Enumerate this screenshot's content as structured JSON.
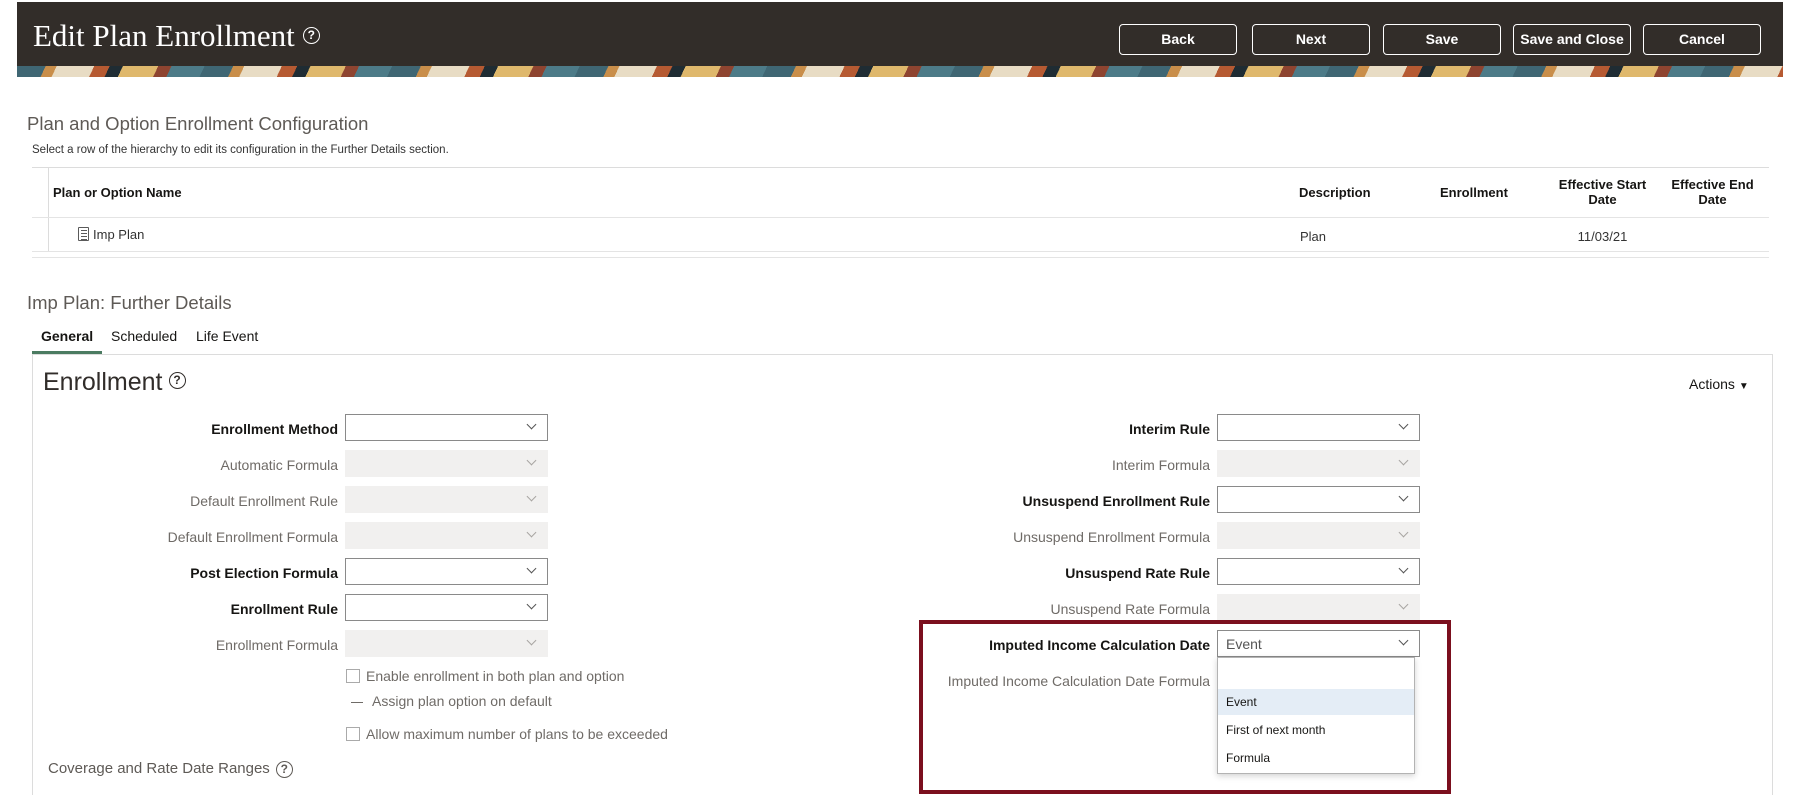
{
  "header": {
    "title": "Edit Plan Enrollment",
    "buttons": {
      "back": "Back",
      "next": "Next",
      "save": "Save",
      "save_close": "Save and Close",
      "cancel": "Cancel"
    }
  },
  "hierarchy": {
    "title": "Plan and Option Enrollment Configuration",
    "instruction": "Select a row of the hierarchy to edit its configuration in the Further Details section.",
    "columns": {
      "name": "Plan or Option Name",
      "description": "Description",
      "enrollment": "Enrollment",
      "start": "Effective Start Date",
      "end": "Effective End Date"
    },
    "rows": [
      {
        "name": "Imp Plan",
        "description": "Plan",
        "enrollment": "",
        "start": "11/03/21",
        "end": ""
      }
    ]
  },
  "details": {
    "title": "Imp Plan: Further Details",
    "tabs": [
      "General",
      "Scheduled",
      "Life Event"
    ],
    "active_tab": "General"
  },
  "enrollment": {
    "title": "Enrollment",
    "actions_label": "Actions",
    "left_fields": [
      {
        "label": "Enrollment Method",
        "value": "",
        "required": true,
        "disabled": false
      },
      {
        "label": "Automatic Formula",
        "value": "",
        "required": false,
        "disabled": true
      },
      {
        "label": "Default Enrollment Rule",
        "value": "",
        "required": false,
        "disabled": true
      },
      {
        "label": "Default Enrollment Formula",
        "value": "",
        "required": false,
        "disabled": true
      },
      {
        "label": "Post Election Formula",
        "value": "",
        "required": true,
        "disabled": false
      },
      {
        "label": "Enrollment Rule",
        "value": "",
        "required": true,
        "disabled": false
      },
      {
        "label": "Enrollment Formula",
        "value": "",
        "required": false,
        "disabled": true
      }
    ],
    "right_fields": [
      {
        "label": "Interim Rule",
        "value": "",
        "required": true,
        "disabled": false
      },
      {
        "label": "Interim Formula",
        "value": "",
        "required": false,
        "disabled": true
      },
      {
        "label": "Unsuspend Enrollment Rule",
        "value": "",
        "required": true,
        "disabled": false
      },
      {
        "label": "Unsuspend Enrollment Formula",
        "value": "",
        "required": false,
        "disabled": true
      },
      {
        "label": "Unsuspend Rate Rule",
        "value": "",
        "required": true,
        "disabled": false
      },
      {
        "label": "Unsuspend Rate Formula",
        "value": "",
        "required": false,
        "disabled": true
      },
      {
        "label": "Imputed Income Calculation Date",
        "value": "Event",
        "required": true,
        "disabled": false
      }
    ],
    "formula_label": "Imputed Income Calculation Date Formula",
    "checkboxes": {
      "enable_both": "Enable enrollment in both plan and option",
      "assign_default": "Assign plan option on default",
      "allow_max": "Allow maximum number of plans to be exceeded"
    },
    "dropdown_options": [
      "",
      "Event",
      "First of next month",
      "Formula"
    ],
    "dropdown_selected": "Event",
    "coverage_title": "Coverage and Rate Date Ranges"
  },
  "colors": {
    "header_bg": "#322d29",
    "highlight": "#7b0f1e",
    "tab_underline": "#4b7b61",
    "option_highlight": "#e4edf6"
  }
}
